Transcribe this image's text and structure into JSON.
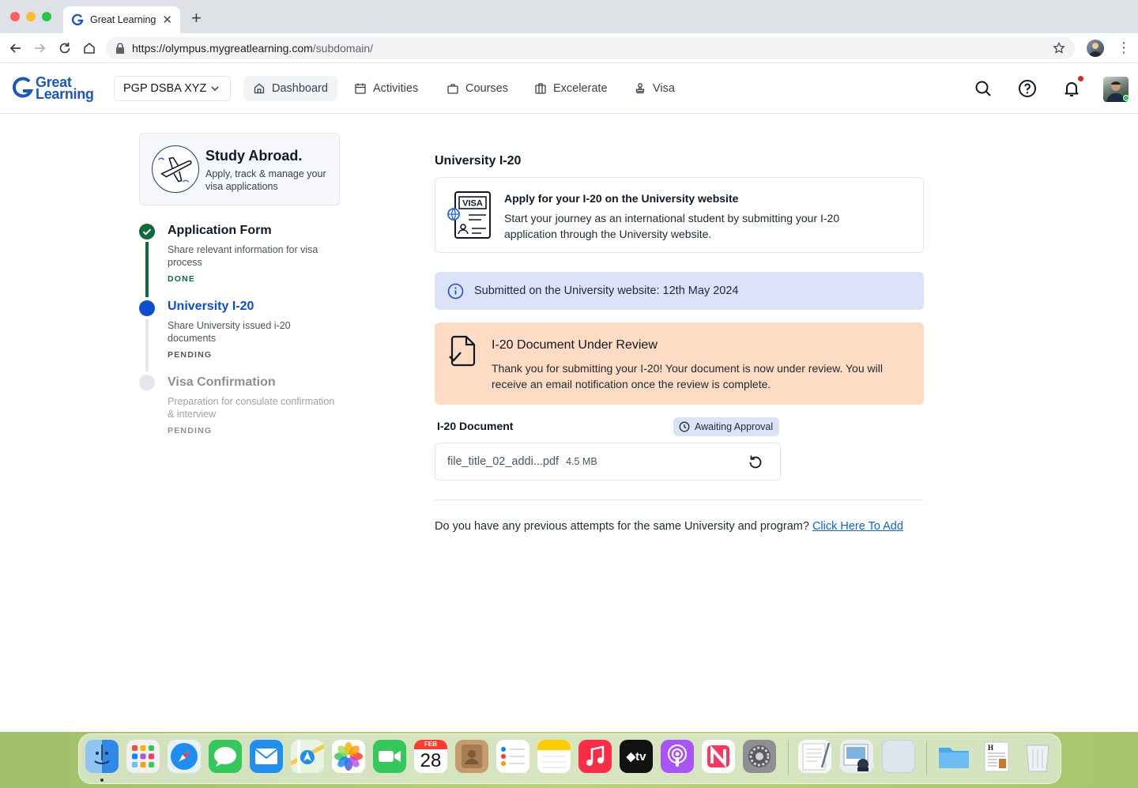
{
  "browser": {
    "tab_title": "Great Learning",
    "url_host": "https://olympus.mygreatlearning.com",
    "url_path": "/subdomain/"
  },
  "header": {
    "logo_line1": "Great",
    "logo_line2": "Learning",
    "program": "PGP DSBA XYZ",
    "nav": [
      {
        "label": "Dashboard",
        "icon": "home-icon",
        "active": true
      },
      {
        "label": "Activities",
        "icon": "calendar-icon"
      },
      {
        "label": "Courses",
        "icon": "briefcase-icon"
      },
      {
        "label": "Excelerate",
        "icon": "building-icon"
      },
      {
        "label": "Visa",
        "icon": "stamp-icon"
      }
    ],
    "has_notification": true
  },
  "sidebar": {
    "card_title": "Study Abroad.",
    "card_subtitle": "Apply, track & manage your visa applications",
    "steps": [
      {
        "title": "Application Form",
        "description": "Share relevant information for visa process",
        "status": "DONE"
      },
      {
        "title": "University I-20",
        "description": "Share University issued i-20 documents",
        "status": "PENDING"
      },
      {
        "title": "Visa Confirmation",
        "description": "Preparation for consulate confirmation & interview",
        "status": "PENDING"
      }
    ]
  },
  "main": {
    "section_title": "University I-20",
    "apply": {
      "title": "Apply for your I-20 on the University website",
      "text": "Start your journey as an international student by submitting your I-20 application through the University website.",
      "icon_label": "VISA"
    },
    "info_banner": "Submitted on the University website: 12th May 2024",
    "review": {
      "title": "I-20 Document Under Review",
      "text": "Thank you for submitting your I-20! Your document is now under review. You will receive an email notification once the review is complete."
    },
    "document": {
      "label": "I-20 Document",
      "badge": "Awaiting Approval",
      "file_name": "file_title_02_addi...pdf",
      "file_size": "4.5 MB"
    },
    "prev_attempts_text": "Do you have any previous attempts for the same University and program?",
    "prev_attempts_link": "Click Here To Add"
  },
  "colors": {
    "brand": "#1a56c4",
    "done": "#0f6b3a",
    "active": "#0b4fd0",
    "pending": "#e5e7eb",
    "info_bg": "#dbe3f9",
    "review_bg": "#fddcc3",
    "link": "#0b63d6"
  },
  "dock": {
    "calendar_month": "FEB",
    "calendar_day": "28",
    "apps": [
      "Finder",
      "Launchpad",
      "Safari",
      "Messages",
      "Mail",
      "Maps",
      "Photos",
      "FaceTime",
      "Calendar",
      "Contacts",
      "Reminders",
      "Notes",
      "Music",
      "TV",
      "Podcasts",
      "News",
      "System Settings",
      "TextEdit",
      "Preview",
      "Blank",
      "Folder",
      "Document",
      "Trash"
    ]
  }
}
